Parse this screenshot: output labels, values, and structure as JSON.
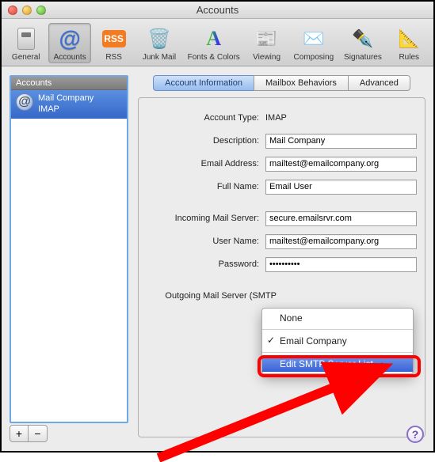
{
  "window": {
    "title": "Accounts"
  },
  "toolbar": [
    {
      "label": "General",
      "icon": "general"
    },
    {
      "label": "Accounts",
      "icon": "at",
      "selected": true
    },
    {
      "label": "RSS",
      "icon": "rss"
    },
    {
      "label": "Junk Mail",
      "icon": "junk"
    },
    {
      "label": "Fonts & Colors",
      "icon": "fonts"
    },
    {
      "label": "Viewing",
      "icon": "view"
    },
    {
      "label": "Composing",
      "icon": "compose"
    },
    {
      "label": "Signatures",
      "icon": "sign"
    },
    {
      "label": "Rules",
      "icon": "rules"
    }
  ],
  "sidebar": {
    "header": "Accounts",
    "items": [
      {
        "title": "Mail Company",
        "subtitle": "IMAP"
      }
    ]
  },
  "tabs": [
    {
      "label": "Account Information",
      "active": true
    },
    {
      "label": "Mailbox Behaviors"
    },
    {
      "label": "Advanced"
    }
  ],
  "form": {
    "account_type_label": "Account Type:",
    "account_type_value": "IMAP",
    "description_label": "Description:",
    "description_value": "Mail Company",
    "email_label": "Email Address:",
    "email_value": "mailtest@emailcompany.org",
    "fullname_label": "Full Name:",
    "fullname_value": "Email User",
    "incoming_label": "Incoming Mail Server:",
    "incoming_value": "secure.emailsrvr.com",
    "username_label": "User Name:",
    "username_value": "mailtest@emailcompany.org",
    "password_label": "Password:",
    "password_value": "••••••••••",
    "smtp_label": "Outgoing Mail Server (SMTP"
  },
  "smtp_menu": {
    "none": "None",
    "selected": "Email Company",
    "edit": "Edit SMTP Server List…"
  },
  "buttons": {
    "add": "+",
    "remove": "−",
    "help": "?"
  }
}
